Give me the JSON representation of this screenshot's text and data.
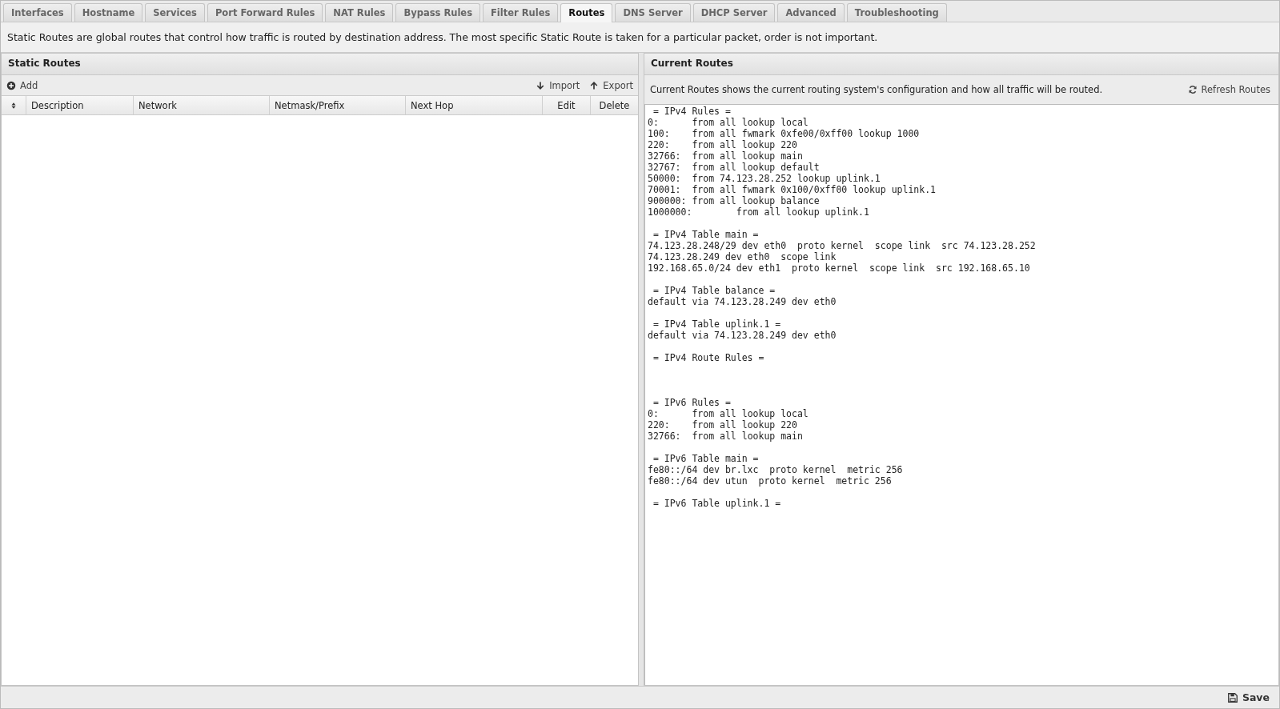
{
  "tabs": [
    {
      "label": "Interfaces",
      "selected": false
    },
    {
      "label": "Hostname",
      "selected": false
    },
    {
      "label": "Services",
      "selected": false
    },
    {
      "label": "Port Forward Rules",
      "selected": false
    },
    {
      "label": "NAT Rules",
      "selected": false
    },
    {
      "label": "Bypass Rules",
      "selected": false
    },
    {
      "label": "Filter Rules",
      "selected": false
    },
    {
      "label": "Routes",
      "selected": true
    },
    {
      "label": "DNS Server",
      "selected": false
    },
    {
      "label": "DHCP Server",
      "selected": false
    },
    {
      "label": "Advanced",
      "selected": false
    },
    {
      "label": "Troubleshooting",
      "selected": false
    }
  ],
  "description": "Static Routes are global routes that control how traffic is routed by destination address. The most specific Static Route is taken for a particular packet, order is not important.",
  "static_routes": {
    "title": "Static Routes",
    "toolbar_left": [
      {
        "label": "Add",
        "kind": "add"
      }
    ],
    "toolbar_right": [
      {
        "label": "Import",
        "kind": "import"
      },
      {
        "label": "Export",
        "kind": "export"
      }
    ],
    "columns": [
      {
        "kind": "sort"
      },
      {
        "kind": "text",
        "label": "Description"
      },
      {
        "kind": "text",
        "label": "Network"
      },
      {
        "kind": "text",
        "label": "Netmask/Prefix"
      },
      {
        "kind": "text",
        "label": "Next Hop"
      },
      {
        "kind": "center",
        "label": "Edit"
      },
      {
        "kind": "center",
        "label": "Delete"
      }
    ]
  },
  "current_routes": {
    "title": "Current Routes",
    "info": "Current Routes shows the current routing system's configuration and how all traffic will be routed.",
    "refresh_button": "Refresh Routes",
    "output": " = IPv4 Rules =\n0:\tfrom all lookup local\n100:\tfrom all fwmark 0xfe00/0xff00 lookup 1000\n220:\tfrom all lookup 220\n32766:\tfrom all lookup main\n32767:\tfrom all lookup default\n50000:\tfrom 74.123.28.252 lookup uplink.1\n70001:\tfrom all fwmark 0x100/0xff00 lookup uplink.1\n900000:\tfrom all lookup balance\n1000000:\tfrom all lookup uplink.1\n\n = IPv4 Table main =\n74.123.28.248/29 dev eth0  proto kernel  scope link  src 74.123.28.252\n74.123.28.249 dev eth0  scope link\n192.168.65.0/24 dev eth1  proto kernel  scope link  src 192.168.65.10\n\n = IPv4 Table balance =\ndefault via 74.123.28.249 dev eth0\n\n = IPv4 Table uplink.1 =\ndefault via 74.123.28.249 dev eth0\n\n = IPv4 Route Rules =\n\n\n\n = IPv6 Rules =\n0:\tfrom all lookup local\n220:\tfrom all lookup 220\n32766:\tfrom all lookup main\n\n = IPv6 Table main =\nfe80::/64 dev br.lxc  proto kernel  metric 256\nfe80::/64 dev utun  proto kernel  metric 256\n\n = IPv6 Table uplink.1 ="
  },
  "footer": {
    "save_button": "Save"
  }
}
